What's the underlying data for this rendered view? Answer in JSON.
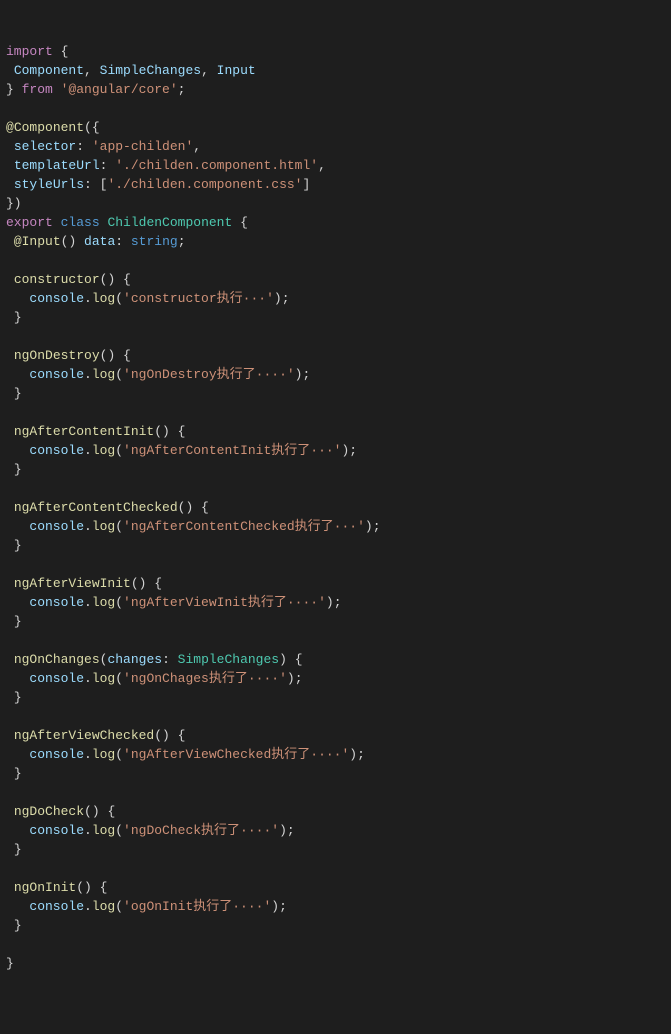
{
  "t": {
    "import": "import",
    "from": "from",
    "export": "export",
    "class": "class",
    "comp": "Component",
    "simpleChanges": "SimpleChanges",
    "input": "Input",
    "angularCore": "'@angular/core'",
    "at": "@",
    "componentDecor": "Component",
    "selector": "selector",
    "selectorVal": "'app-childen'",
    "templateUrl": "templateUrl",
    "templateUrlVal": "'./childen.component.html'",
    "styleUrls": "styleUrls",
    "styleUrlsVal": "'./childen.component.css'",
    "className": "ChildenComponent",
    "inputDecor": "Input",
    "data": "data",
    "string": "string",
    "constructor": "constructor",
    "console": "console",
    "log": "log",
    "msgConstructor": "'constructor执行···'",
    "ngOnDestroy": "ngOnDestroy",
    "msgNgOnDestroy": "'ngOnDestroy执行了····'",
    "ngAfterContentInit": "ngAfterContentInit",
    "msgNgAfterContentInit": "'ngAfterContentInit执行了···'",
    "ngAfterContentChecked": "ngAfterContentChecked",
    "msgNgAfterContentChecked": "'ngAfterContentChecked执行了···'",
    "ngAfterViewInit": "ngAfterViewInit",
    "msgNgAfterViewInit": "'ngAfterViewInit执行了····'",
    "ngOnChanges": "ngOnChanges",
    "changes": "changes",
    "simpleChangesType": "SimpleChanges",
    "msgNgOnChanges": "'ngOnChages执行了····'",
    "ngAfterViewChecked": "ngAfterViewChecked",
    "msgNgAfterViewChecked": "'ngAfterViewChecked执行了····'",
    "ngDoCheck": "ngDoCheck",
    "msgNgDoCheck": "'ngDoCheck执行了····'",
    "ngOnInit": "ngOnInit",
    "msgNgOnInit": "'ogOnInit执行了····'"
  }
}
